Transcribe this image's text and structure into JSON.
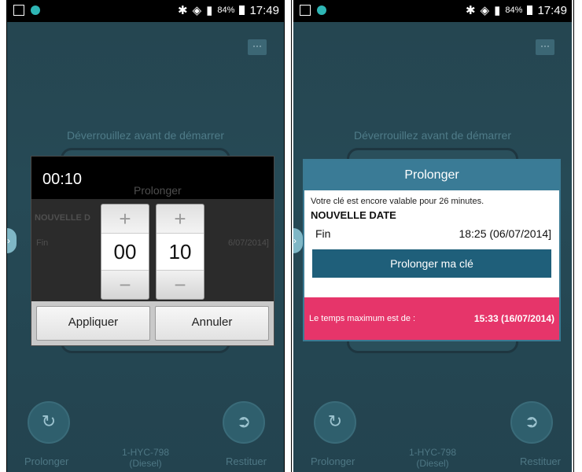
{
  "status": {
    "battery": "84%",
    "time": "17:49"
  },
  "menu_label": "···",
  "unlock_text": "Déverrouillez avant de démarrer",
  "bottom": {
    "prolonger": "Prolonger",
    "plate": "1-HYC-798",
    "fuel": "(Diesel)",
    "restituer": "Restituer"
  },
  "picker": {
    "time": "00:10",
    "ghost_title": "Prolonger",
    "ghost_new": "NOUVELLE D",
    "ghost_fin": "Fin",
    "ghost_date": "6/07/2014]",
    "hours": "00",
    "minutes": "10",
    "plus": "+",
    "minus": "−",
    "apply": "Appliquer",
    "cancel": "Annuler"
  },
  "dialog": {
    "title": "Prolonger",
    "info": "Votre clé est encore valable pour 26 minutes.",
    "new_date": "NOUVELLE DATE",
    "fin_label": "Fin",
    "fin_value": "18:25 (06/07/2014]",
    "button": "Prolonger ma clé",
    "max_label": "Le temps maximum est de :",
    "max_value": "15:33 (16/07/2014)"
  },
  "colors": {
    "accent": "#3a7b96",
    "alert": "#e6356a",
    "bg": "#254550"
  }
}
